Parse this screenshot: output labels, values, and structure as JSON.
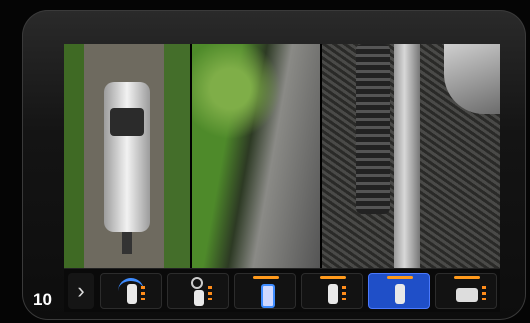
{
  "page": {
    "number": "10"
  },
  "colors": {
    "active_view": "#1f4fc8",
    "accent_orange": "#ff9a1c",
    "arc_blue": "#3e8cff"
  },
  "toolbar": {
    "nav_label": "›",
    "views": [
      {
        "id": "front-camera",
        "icon": "truck-front-arc-icon",
        "active": false
      },
      {
        "id": "zoom-camera",
        "icon": "truck-magnify-icon",
        "active": false
      },
      {
        "id": "top-down",
        "icon": "truck-outline-icon",
        "active": false
      },
      {
        "id": "side-camera",
        "icon": "truck-side-icon",
        "active": false
      },
      {
        "id": "rear-side",
        "icon": "truck-active-icon",
        "active": true
      },
      {
        "id": "trailer-view",
        "icon": "trailer-icon",
        "active": false
      }
    ]
  }
}
